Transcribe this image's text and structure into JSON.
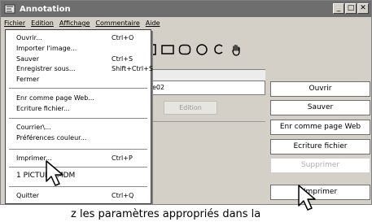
{
  "window": {
    "title": "Annotation",
    "controls": [
      "minimize",
      "maximize",
      "close"
    ]
  },
  "menubar": {
    "items": [
      "Fichier",
      "Edition",
      "Affichage",
      "Commentaire",
      "Aide"
    ]
  },
  "file_menu": {
    "items": [
      {
        "label": "Ouvrir...",
        "shortcut": "Ctrl+O"
      },
      {
        "label": "Importer l'image...",
        "shortcut": ""
      },
      {
        "label": "Sauver",
        "shortcut": "Ctrl+S"
      },
      {
        "label": "Enregistrer sous...",
        "shortcut": "Shift+Ctrl+S"
      },
      {
        "label": "Fermer",
        "shortcut": ""
      },
      {
        "label": "Enr comme page Web...",
        "shortcut": ""
      },
      {
        "label": "Ecriture fichier...",
        "shortcut": ""
      },
      {
        "label": "Courrier\\...",
        "shortcut": ""
      },
      {
        "label": "Préférences couleur...",
        "shortcut": ""
      },
      {
        "label": "Imprimer...",
        "shortcut": "Ctrl+P"
      },
      {
        "label": "1 PICTURE.MDM",
        "shortcut": ""
      },
      {
        "label": "Quitter",
        "shortcut": "Ctrl+Q"
      }
    ]
  },
  "main": {
    "field_value": "e02",
    "edition_button": "Edition"
  },
  "right_buttons": [
    {
      "label": "Ouvrir",
      "enabled": true
    },
    {
      "label": "Sauver",
      "enabled": true
    },
    {
      "label": "Enr comme page Web",
      "enabled": true
    },
    {
      "label": "Ecriture fichier",
      "enabled": true
    },
    {
      "label": "Supprimer",
      "enabled": false
    },
    {
      "label": "Imprimer",
      "enabled": true
    }
  ],
  "caption": "z les paramètres appropriés dans la",
  "toolbar_icons": [
    "square-icon",
    "rectangle-icon",
    "rounded-rectangle-icon",
    "circle-icon",
    "freehand-icon",
    "hand-icon"
  ],
  "colors": {
    "titlebar": "#6e6e6e",
    "window_bg": "#d4d0c8"
  }
}
